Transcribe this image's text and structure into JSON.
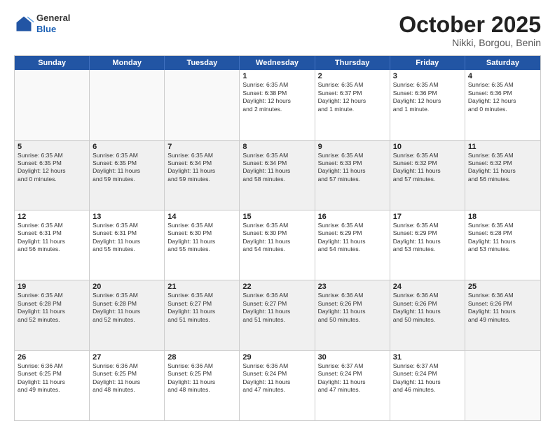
{
  "header": {
    "logo": {
      "general": "General",
      "blue": "Blue"
    },
    "title": "October 2025",
    "location": "Nikki, Borgou, Benin"
  },
  "days": [
    "Sunday",
    "Monday",
    "Tuesday",
    "Wednesday",
    "Thursday",
    "Friday",
    "Saturday"
  ],
  "weeks": [
    [
      {
        "date": "",
        "info": ""
      },
      {
        "date": "",
        "info": ""
      },
      {
        "date": "",
        "info": ""
      },
      {
        "date": "1",
        "info": "Sunrise: 6:35 AM\nSunset: 6:38 PM\nDaylight: 12 hours\nand 2 minutes."
      },
      {
        "date": "2",
        "info": "Sunrise: 6:35 AM\nSunset: 6:37 PM\nDaylight: 12 hours\nand 1 minute."
      },
      {
        "date": "3",
        "info": "Sunrise: 6:35 AM\nSunset: 6:36 PM\nDaylight: 12 hours\nand 1 minute."
      },
      {
        "date": "4",
        "info": "Sunrise: 6:35 AM\nSunset: 6:36 PM\nDaylight: 12 hours\nand 0 minutes."
      }
    ],
    [
      {
        "date": "5",
        "info": "Sunrise: 6:35 AM\nSunset: 6:35 PM\nDaylight: 12 hours\nand 0 minutes."
      },
      {
        "date": "6",
        "info": "Sunrise: 6:35 AM\nSunset: 6:35 PM\nDaylight: 11 hours\nand 59 minutes."
      },
      {
        "date": "7",
        "info": "Sunrise: 6:35 AM\nSunset: 6:34 PM\nDaylight: 11 hours\nand 59 minutes."
      },
      {
        "date": "8",
        "info": "Sunrise: 6:35 AM\nSunset: 6:34 PM\nDaylight: 11 hours\nand 58 minutes."
      },
      {
        "date": "9",
        "info": "Sunrise: 6:35 AM\nSunset: 6:33 PM\nDaylight: 11 hours\nand 57 minutes."
      },
      {
        "date": "10",
        "info": "Sunrise: 6:35 AM\nSunset: 6:32 PM\nDaylight: 11 hours\nand 57 minutes."
      },
      {
        "date": "11",
        "info": "Sunrise: 6:35 AM\nSunset: 6:32 PM\nDaylight: 11 hours\nand 56 minutes."
      }
    ],
    [
      {
        "date": "12",
        "info": "Sunrise: 6:35 AM\nSunset: 6:31 PM\nDaylight: 11 hours\nand 56 minutes."
      },
      {
        "date": "13",
        "info": "Sunrise: 6:35 AM\nSunset: 6:31 PM\nDaylight: 11 hours\nand 55 minutes."
      },
      {
        "date": "14",
        "info": "Sunrise: 6:35 AM\nSunset: 6:30 PM\nDaylight: 11 hours\nand 55 minutes."
      },
      {
        "date": "15",
        "info": "Sunrise: 6:35 AM\nSunset: 6:30 PM\nDaylight: 11 hours\nand 54 minutes."
      },
      {
        "date": "16",
        "info": "Sunrise: 6:35 AM\nSunset: 6:29 PM\nDaylight: 11 hours\nand 54 minutes."
      },
      {
        "date": "17",
        "info": "Sunrise: 6:35 AM\nSunset: 6:29 PM\nDaylight: 11 hours\nand 53 minutes."
      },
      {
        "date": "18",
        "info": "Sunrise: 6:35 AM\nSunset: 6:28 PM\nDaylight: 11 hours\nand 53 minutes."
      }
    ],
    [
      {
        "date": "19",
        "info": "Sunrise: 6:35 AM\nSunset: 6:28 PM\nDaylight: 11 hours\nand 52 minutes."
      },
      {
        "date": "20",
        "info": "Sunrise: 6:35 AM\nSunset: 6:28 PM\nDaylight: 11 hours\nand 52 minutes."
      },
      {
        "date": "21",
        "info": "Sunrise: 6:35 AM\nSunset: 6:27 PM\nDaylight: 11 hours\nand 51 minutes."
      },
      {
        "date": "22",
        "info": "Sunrise: 6:36 AM\nSunset: 6:27 PM\nDaylight: 11 hours\nand 51 minutes."
      },
      {
        "date": "23",
        "info": "Sunrise: 6:36 AM\nSunset: 6:26 PM\nDaylight: 11 hours\nand 50 minutes."
      },
      {
        "date": "24",
        "info": "Sunrise: 6:36 AM\nSunset: 6:26 PM\nDaylight: 11 hours\nand 50 minutes."
      },
      {
        "date": "25",
        "info": "Sunrise: 6:36 AM\nSunset: 6:26 PM\nDaylight: 11 hours\nand 49 minutes."
      }
    ],
    [
      {
        "date": "26",
        "info": "Sunrise: 6:36 AM\nSunset: 6:25 PM\nDaylight: 11 hours\nand 49 minutes."
      },
      {
        "date": "27",
        "info": "Sunrise: 6:36 AM\nSunset: 6:25 PM\nDaylight: 11 hours\nand 48 minutes."
      },
      {
        "date": "28",
        "info": "Sunrise: 6:36 AM\nSunset: 6:25 PM\nDaylight: 11 hours\nand 48 minutes."
      },
      {
        "date": "29",
        "info": "Sunrise: 6:36 AM\nSunset: 6:24 PM\nDaylight: 11 hours\nand 47 minutes."
      },
      {
        "date": "30",
        "info": "Sunrise: 6:37 AM\nSunset: 6:24 PM\nDaylight: 11 hours\nand 47 minutes."
      },
      {
        "date": "31",
        "info": "Sunrise: 6:37 AM\nSunset: 6:24 PM\nDaylight: 11 hours\nand 46 minutes."
      },
      {
        "date": "",
        "info": ""
      }
    ]
  ]
}
